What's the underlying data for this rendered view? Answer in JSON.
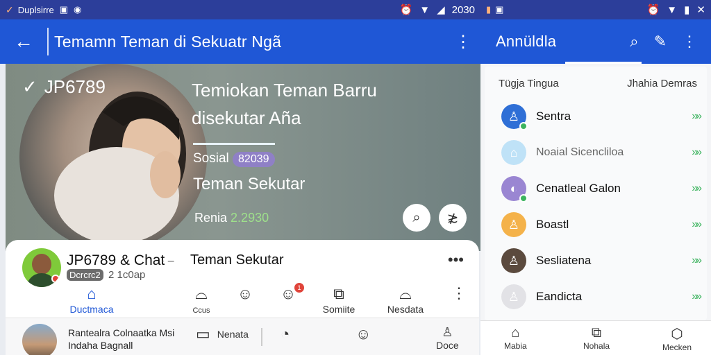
{
  "left": {
    "status": {
      "app": "Duplsirre",
      "time": "2030"
    },
    "appbar": {
      "title": "Temamn Teman di Sekuatr Ngã",
      "back": "←",
      "more": "⋮"
    },
    "hero": {
      "brand": "JP6789",
      "title_line1": "Temiokan Teman Barru",
      "title_line2": "disekutar Aña",
      "social_label": "Sosial",
      "social_pill": "82039",
      "teman": "Teman Sekutar",
      "renia_label": "Renia",
      "renia_value": "2.2930"
    },
    "sheet": {
      "name": "JP6789 & Chat",
      "sep": "· –",
      "subtitle": "Teman Sekutar",
      "tag": "Dcrcrc2",
      "tagnum": "2 1c0ap",
      "tabs": [
        {
          "label": "Ductmaca",
          "icon": "⌂"
        },
        {
          "label": "Ccus",
          "icon": "⌓"
        },
        {
          "label": "",
          "icon": "☺"
        },
        {
          "label": "",
          "icon": "☺"
        },
        {
          "label": "Somiite",
          "icon": "⧉"
        },
        {
          "label": "Nesdata",
          "icon": "⌓"
        }
      ],
      "badge": "1"
    },
    "bottom": {
      "text_line1": "Rantealra Colnaatka Msi",
      "text_line2": "Indaha Bagnall",
      "nenata": "Nenata",
      "doce": "Doce"
    }
  },
  "right": {
    "status": {
      "time": ""
    },
    "appbar": {
      "title": "Annüldla"
    },
    "header": {
      "left": "Tügja Tingua",
      "right": "Jhahia Demras"
    },
    "rows": [
      {
        "label": "Sentra",
        "color": "#2f6fd6",
        "muted": false
      },
      {
        "label": "Noaial Sicencliloa",
        "color": "#bfe2f7",
        "muted": true
      },
      {
        "label": "Cenatleal Galon",
        "color": "#9a86d2",
        "muted": false
      },
      {
        "label": "Boastl",
        "color": "#f4b24a",
        "muted": false
      },
      {
        "label": "Sesliatena",
        "color": "#5b4a3e",
        "muted": false
      },
      {
        "label": "Eandicta",
        "color": "#e2e2e6",
        "muted": false
      }
    ],
    "footer": [
      "Mabia",
      "Nohala",
      "Mecken"
    ]
  }
}
